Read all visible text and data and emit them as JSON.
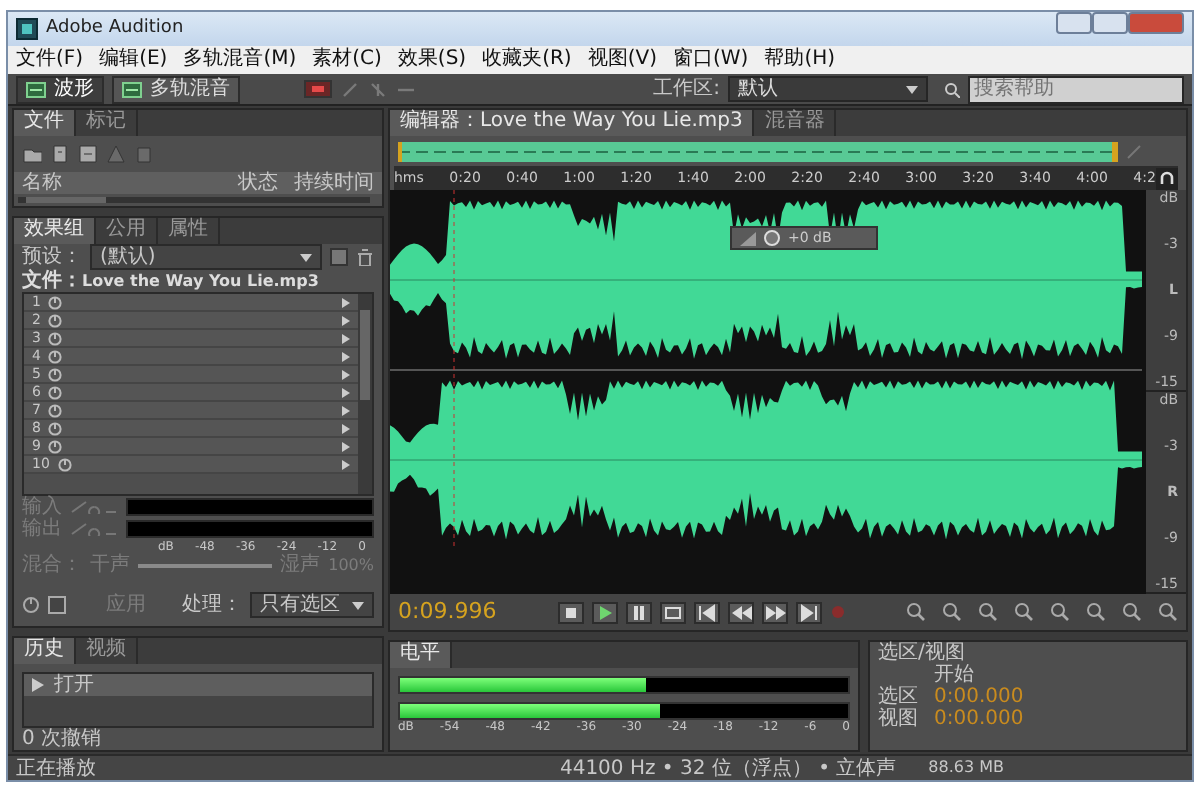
{
  "window": {
    "title": "Adobe Audition"
  },
  "menu": [
    "文件(F)",
    "编辑(E)",
    "多轨混音(M)",
    "素材(C)",
    "效果(S)",
    "收藏夹(R)",
    "视图(V)",
    "窗口(W)",
    "帮助(H)"
  ],
  "toolbar": {
    "modes": [
      {
        "label": "波形",
        "selected": true
      },
      {
        "label": "多轨混音",
        "selected": false
      }
    ],
    "workspace_label": "工作区:",
    "workspace_value": "默认",
    "search_placeholder": "搜索帮助"
  },
  "files_panel": {
    "tabs": [
      {
        "label": "文件",
        "selected": true
      },
      {
        "label": "标记",
        "selected": false
      }
    ],
    "columns": [
      "名称",
      "状态",
      "持续时间"
    ]
  },
  "effects_panel": {
    "tabs": [
      {
        "label": "效果组",
        "selected": true
      },
      {
        "label": "公用",
        "selected": false
      },
      {
        "label": "属性",
        "selected": false
      }
    ],
    "preset_label": "预设：",
    "preset_value": "(默认)",
    "file_label": "文件：",
    "file_name": "Love the Way You Lie.mp3",
    "slots": [
      "1",
      "2",
      "3",
      "4",
      "5",
      "6",
      "7",
      "8",
      "9",
      "10"
    ],
    "input_label": "输入",
    "output_label": "输出",
    "meter_scale": [
      "dB",
      "-48",
      "-36",
      "-24",
      "-12",
      "0"
    ],
    "mix_label": "混合：",
    "mix_slider": {
      "level": 1
    },
    "dry_label": "干声",
    "wet_label": "湿声",
    "wet_value": "100%",
    "apply_label": "应用",
    "process_label": "处理：",
    "process_value": "只有选区"
  },
  "history_panel": {
    "tabs": [
      {
        "label": "历史",
        "selected": true
      },
      {
        "label": "视频",
        "selected": false
      }
    ],
    "items": [
      {
        "label": "打开",
        "selected": true
      }
    ],
    "undo_count": "0 次撤销"
  },
  "editor": {
    "tabs": [
      {
        "label": "编辑器：Love the Way You Lie.mp3",
        "selected": true
      },
      {
        "label": "混音器",
        "selected": false
      }
    ],
    "ruler": [
      "hms",
      "0:20",
      "0:40",
      "1:00",
      "1:20",
      "1:40",
      "2:00",
      "2:20",
      "2:40",
      "3:00",
      "3:20",
      "3:40",
      "4:00",
      "4:2"
    ],
    "channels": [
      {
        "unit": "dB",
        "label": "L",
        "ticks": [
          "-3",
          "-9",
          "-15"
        ]
      },
      {
        "unit": "dB",
        "label": "R",
        "ticks": [
          "-3",
          "-9",
          "-15"
        ]
      }
    ],
    "hud_reading": "+0 dB",
    "current_time": "0:09.996"
  },
  "level_meter": {
    "tab": "电平",
    "channels": [
      {
        "level": 0.55
      },
      {
        "level": 0.58
      }
    ],
    "scale": [
      "dB",
      "-54",
      "-48",
      "-42",
      "-36",
      "-30",
      "-24",
      "-18",
      "-12",
      "-6",
      "0"
    ]
  },
  "selection_panel": {
    "title": "选区/视图",
    "column": "开始",
    "rows": [
      {
        "label": "选区",
        "value": "0:00.000"
      },
      {
        "label": "视图",
        "value": "0:00.000"
      }
    ]
  },
  "status_bar": {
    "left": "正在播放",
    "info": "44100 Hz • 32 位（浮点） • 立体声",
    "size": "88.63 MB"
  }
}
